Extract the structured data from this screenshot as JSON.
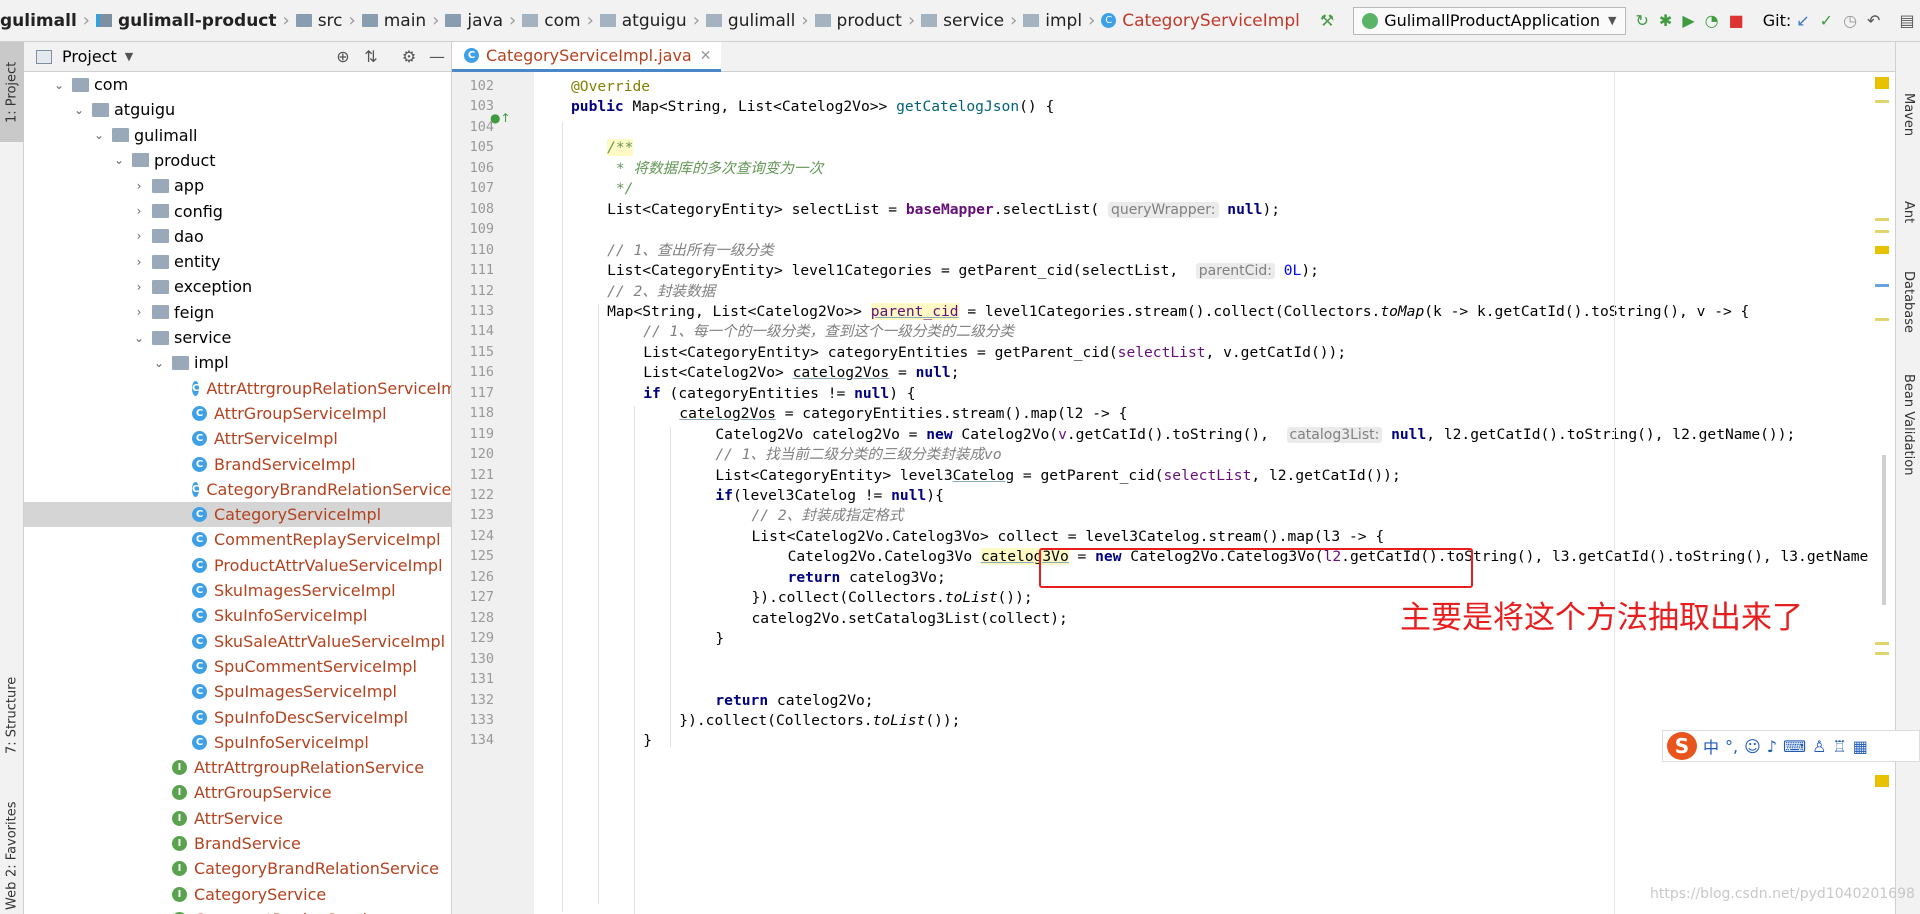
{
  "breadcrumb": [
    {
      "label": "gulimall",
      "bold": true,
      "icon": "none"
    },
    {
      "label": "gulimall-product",
      "bold": true,
      "icon": "module"
    },
    {
      "label": "src",
      "icon": "folder"
    },
    {
      "label": "main",
      "icon": "folder"
    },
    {
      "label": "java",
      "icon": "folder"
    },
    {
      "label": "com",
      "icon": "package"
    },
    {
      "label": "atguigu",
      "icon": "package"
    },
    {
      "label": "gulimall",
      "icon": "package"
    },
    {
      "label": "product",
      "icon": "package"
    },
    {
      "label": "service",
      "icon": "package"
    },
    {
      "label": "impl",
      "icon": "package"
    },
    {
      "label": "CategoryServiceImpl",
      "icon": "class"
    }
  ],
  "toolbar": {
    "run_config": "GulimallProductApplication",
    "git_label": "Git:"
  },
  "left_tabs": {
    "project": "1: Project",
    "structure": "7: Structure",
    "favorites": "2: Favorites",
    "web": "Web"
  },
  "right_tabs": {
    "maven": "Maven",
    "ant": "Ant",
    "database": "Database",
    "bean_validation": "Bean Validation"
  },
  "project_panel": {
    "title": "Project",
    "tree": [
      {
        "label": "com",
        "type": "package",
        "depth": 1,
        "expanded": true
      },
      {
        "label": "atguigu",
        "type": "package",
        "depth": 2,
        "expanded": true
      },
      {
        "label": "gulimall",
        "type": "package",
        "depth": 3,
        "expanded": true
      },
      {
        "label": "product",
        "type": "package",
        "depth": 4,
        "expanded": true
      },
      {
        "label": "app",
        "type": "package",
        "depth": 5,
        "expanded": false
      },
      {
        "label": "config",
        "type": "package",
        "depth": 5,
        "expanded": false
      },
      {
        "label": "dao",
        "type": "package",
        "depth": 5,
        "expanded": false
      },
      {
        "label": "entity",
        "type": "package",
        "depth": 5,
        "expanded": false
      },
      {
        "label": "exception",
        "type": "package",
        "depth": 5,
        "expanded": false
      },
      {
        "label": "feign",
        "type": "package",
        "depth": 5,
        "expanded": false
      },
      {
        "label": "service",
        "type": "package",
        "depth": 5,
        "expanded": true
      },
      {
        "label": "impl",
        "type": "package",
        "depth": 6,
        "expanded": true
      },
      {
        "label": "AttrAttrgroupRelationServiceImpl",
        "type": "class",
        "depth": 7
      },
      {
        "label": "AttrGroupServiceImpl",
        "type": "class",
        "depth": 7
      },
      {
        "label": "AttrServiceImpl",
        "type": "class",
        "depth": 7
      },
      {
        "label": "BrandServiceImpl",
        "type": "class",
        "depth": 7
      },
      {
        "label": "CategoryBrandRelationServiceImpl",
        "type": "class",
        "depth": 7
      },
      {
        "label": "CategoryServiceImpl",
        "type": "class",
        "depth": 7,
        "selected": true
      },
      {
        "label": "CommentReplayServiceImpl",
        "type": "class",
        "depth": 7
      },
      {
        "label": "ProductAttrValueServiceImpl",
        "type": "class",
        "depth": 7
      },
      {
        "label": "SkuImagesServiceImpl",
        "type": "class",
        "depth": 7
      },
      {
        "label": "SkuInfoServiceImpl",
        "type": "class",
        "depth": 7
      },
      {
        "label": "SkuSaleAttrValueServiceImpl",
        "type": "class",
        "depth": 7
      },
      {
        "label": "SpuCommentServiceImpl",
        "type": "class",
        "depth": 7
      },
      {
        "label": "SpuImagesServiceImpl",
        "type": "class",
        "depth": 7
      },
      {
        "label": "SpuInfoDescServiceImpl",
        "type": "class",
        "depth": 7
      },
      {
        "label": "SpuInfoServiceImpl",
        "type": "class",
        "depth": 7
      },
      {
        "label": "AttrAttrgroupRelationService",
        "type": "interface",
        "depth": 6
      },
      {
        "label": "AttrGroupService",
        "type": "interface",
        "depth": 6
      },
      {
        "label": "AttrService",
        "type": "interface",
        "depth": 6
      },
      {
        "label": "BrandService",
        "type": "interface",
        "depth": 6
      },
      {
        "label": "CategoryBrandRelationService",
        "type": "interface",
        "depth": 6
      },
      {
        "label": "CategoryService",
        "type": "interface",
        "depth": 6
      },
      {
        "label": "CommentReplayService",
        "type": "interface",
        "depth": 6
      }
    ]
  },
  "editor": {
    "tab_label": "CategoryServiceImpl.java",
    "lines": [
      {
        "n": "102",
        "indent": 0,
        "parts": [
          [
            "ann",
            "@Override"
          ]
        ]
      },
      {
        "n": "103",
        "indent": 0,
        "parts": [
          [
            "kw",
            "public "
          ],
          [
            "",
            "Map<String, List<Catelog2Vo>> "
          ],
          [
            "mth",
            "getCatelogJson"
          ],
          [
            "",
            "() {"
          ]
        ]
      },
      {
        "n": "104",
        "indent": 0,
        "parts": []
      },
      {
        "n": "105",
        "indent": 1,
        "parts": [
          [
            "dcmt hl",
            "/**"
          ]
        ]
      },
      {
        "n": "106",
        "indent": 1,
        "parts": [
          [
            "dcmt",
            " * 将数据库的多次查询变为一次"
          ]
        ]
      },
      {
        "n": "107",
        "indent": 1,
        "parts": [
          [
            "dcmt",
            " */"
          ]
        ]
      },
      {
        "n": "108",
        "indent": 1,
        "parts": [
          [
            "",
            "List<CategoryEntity> selectList = "
          ],
          [
            "fldb",
            "baseMapper"
          ],
          [
            "",
            ".selectList( "
          ],
          [
            "hint",
            "queryWrapper:"
          ],
          [
            "kw",
            " null"
          ],
          [
            "",
            ");"
          ]
        ]
      },
      {
        "n": "109",
        "indent": 0,
        "parts": []
      },
      {
        "n": "110",
        "indent": 1,
        "parts": [
          [
            "cmt",
            "// 1、查出所有一级分类"
          ]
        ]
      },
      {
        "n": "111",
        "indent": 1,
        "parts": [
          [
            "",
            "List<CategoryEntity> level1Categories = getParent_cid(selectList,  "
          ],
          [
            "hint",
            "parentCid:"
          ],
          [
            "num",
            " 0L"
          ],
          [
            "",
            ");"
          ]
        ]
      },
      {
        "n": "112",
        "indent": 1,
        "parts": [
          [
            "cmt",
            "// 2、封装数据"
          ]
        ]
      },
      {
        "n": "113",
        "indent": 1,
        "parts": [
          [
            "",
            "Map<String, List<Catelog2Vo>> "
          ],
          [
            "fld hl und",
            "parent_cid"
          ],
          [
            "",
            " = level1Categories.stream().collect(Collectors."
          ],
          [
            "it",
            "toMap"
          ],
          [
            "",
            "(k -> k.getCatId().toString(), v -> {"
          ]
        ]
      },
      {
        "n": "114",
        "indent": 2,
        "parts": [
          [
            "cmt",
            "// 1、每一个的一级分类，查到这个一级分类的二级分类"
          ]
        ]
      },
      {
        "n": "115",
        "indent": 2,
        "parts": [
          [
            "",
            "List<CategoryEntity> categoryEntities = getParent_cid("
          ],
          [
            "fld",
            "selectList"
          ],
          [
            "",
            ", v.getCatId());"
          ]
        ]
      },
      {
        "n": "116",
        "indent": 2,
        "parts": [
          [
            "",
            "List<Catelog2Vo> "
          ],
          [
            "und",
            "catelog2Vos"
          ],
          [
            "",
            " = "
          ],
          [
            "kw",
            "null"
          ],
          [
            "",
            ";"
          ]
        ]
      },
      {
        "n": "117",
        "indent": 2,
        "parts": [
          [
            "kw",
            "if "
          ],
          [
            "",
            "(categoryEntities != "
          ],
          [
            "kw",
            "null"
          ],
          [
            "",
            ") {"
          ]
        ]
      },
      {
        "n": "118",
        "indent": 3,
        "parts": [
          [
            "und",
            "catelog2Vos"
          ],
          [
            "",
            " = categoryEntities.stream().map(l2 -> {"
          ]
        ]
      },
      {
        "n": "119",
        "indent": 4,
        "parts": [
          [
            "",
            "Catelog2Vo catelog2Vo = "
          ],
          [
            "kw",
            "new "
          ],
          [
            "",
            "Catelog2Vo("
          ],
          [
            "fld",
            "v"
          ],
          [
            "",
            ".getCatId().toString(),  "
          ],
          [
            "hint",
            "catalog3List:"
          ],
          [
            "kw",
            " null"
          ],
          [
            "",
            ", l2.getCatId().toString(), l2.getName());"
          ]
        ]
      },
      {
        "n": "120",
        "indent": 4,
        "parts": [
          [
            "cmt",
            "// 1、找当前二级分类的三级分类封装成vo"
          ]
        ]
      },
      {
        "n": "121",
        "indent": 4,
        "parts": [
          [
            "",
            "List<CategoryEntity> level3"
          ],
          [
            "und",
            "Catelog"
          ],
          [
            "",
            " = getParent_cid("
          ],
          [
            "fld",
            "selectList"
          ],
          [
            "",
            ", l2.getCatId());"
          ]
        ]
      },
      {
        "n": "122",
        "indent": 4,
        "parts": [
          [
            "kw",
            "if"
          ],
          [
            "",
            "(level3Catelog != "
          ],
          [
            "kw",
            "null"
          ],
          [
            "",
            "){"
          ]
        ]
      },
      {
        "n": "123",
        "indent": 5,
        "parts": [
          [
            "cmt",
            "// 2、封装成指定格式"
          ]
        ]
      },
      {
        "n": "124",
        "indent": 5,
        "parts": [
          [
            "",
            "List<Catelog2Vo.Catelog3Vo> collect = level3Catelog.stream().map(l3 -> {"
          ]
        ]
      },
      {
        "n": "125",
        "indent": 6,
        "parts": [
          [
            "",
            "Catelog2Vo.Catelog3Vo "
          ],
          [
            "hl und",
            "catelog3Vo"
          ],
          [
            "",
            " = "
          ],
          [
            "kw",
            "new "
          ],
          [
            "",
            "Catelog2Vo.Catelog3Vo("
          ],
          [
            "fld",
            "l2"
          ],
          [
            "",
            ".getCatId().toString(), l3.getCatId().toString(), l3.getName"
          ]
        ]
      },
      {
        "n": "126",
        "indent": 6,
        "parts": [
          [
            "kw",
            "return "
          ],
          [
            "",
            "catelog3Vo;"
          ]
        ]
      },
      {
        "n": "127",
        "indent": 5,
        "parts": [
          [
            "",
            "}).collect(Collectors."
          ],
          [
            "it",
            "toList"
          ],
          [
            "",
            "());"
          ]
        ]
      },
      {
        "n": "128",
        "indent": 5,
        "parts": [
          [
            "",
            "catelog2Vo.setCatalog3List(collect);"
          ]
        ]
      },
      {
        "n": "129",
        "indent": 4,
        "parts": [
          [
            "",
            "}"
          ]
        ]
      },
      {
        "n": "130",
        "indent": 0,
        "parts": []
      },
      {
        "n": "131",
        "indent": 0,
        "parts": []
      },
      {
        "n": "132",
        "indent": 4,
        "parts": [
          [
            "kw",
            "return "
          ],
          [
            "",
            "catelog2Vo;"
          ]
        ]
      },
      {
        "n": "133",
        "indent": 3,
        "parts": [
          [
            "",
            "}).collect(Collectors."
          ],
          [
            "it",
            "toList"
          ],
          [
            "",
            "());"
          ]
        ]
      },
      {
        "n": "134",
        "indent": 2,
        "parts": [
          [
            "",
            "}"
          ]
        ]
      }
    ]
  },
  "annotation_text": "主要是将这个方法抽取出来了",
  "ime_toolbar": {
    "logo": "S",
    "mode": "中",
    "punct": "°,"
  },
  "watermark": "https://blog.csdn.net/pyd1040201698"
}
